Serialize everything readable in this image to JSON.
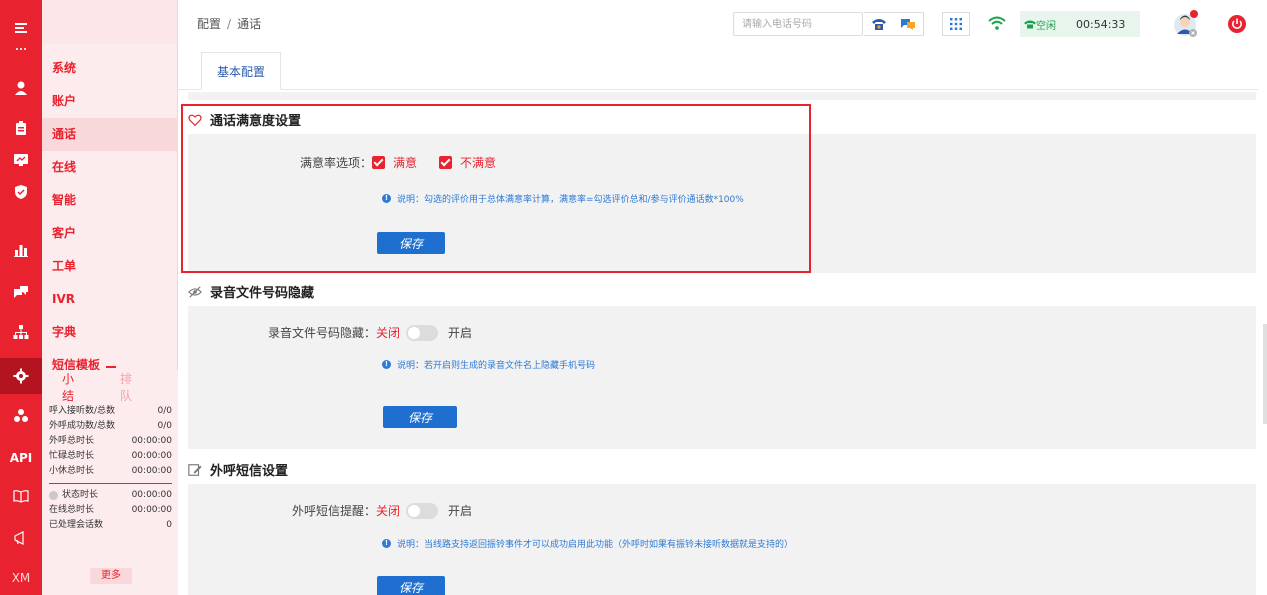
{
  "rail": {
    "icons": [
      "menu-icon",
      "user-icon",
      "clipboard-icon",
      "monitor-icon",
      "shield-icon",
      "bar-chart-icon",
      "chat-icon",
      "org-chart-icon",
      "settings-icon",
      "cluster-icon",
      "api-text",
      "book-icon",
      "megaphone-icon",
      "xm-text"
    ],
    "api_label": "API",
    "xm_label": "XM"
  },
  "submenu": {
    "items": [
      {
        "label": "系统"
      },
      {
        "label": "账户"
      },
      {
        "label": "通话"
      },
      {
        "label": "在线"
      },
      {
        "label": "智能"
      },
      {
        "label": "客户"
      },
      {
        "label": "工单"
      },
      {
        "label": "IVR"
      },
      {
        "label": "字典"
      },
      {
        "label": "短信模板"
      }
    ],
    "active_index": 2
  },
  "summary": {
    "tabs": [
      "小结",
      "排队"
    ],
    "rows_a": [
      {
        "label": "呼入接听数/总数",
        "value": "0/0"
      },
      {
        "label": "外呼成功数/总数",
        "value": "0/0"
      },
      {
        "label": "外呼总时长",
        "value": "00:00:00"
      },
      {
        "label": "忙碌总时长",
        "value": "00:00:00"
      },
      {
        "label": "小休总时长",
        "value": "00:00:00"
      }
    ],
    "rows_b": [
      {
        "label": "状态时长",
        "value": "00:00:00"
      },
      {
        "label": "在线总时长",
        "value": "00:00:00"
      },
      {
        "label": "已处理会话数",
        "value": "0"
      }
    ],
    "more": "更多"
  },
  "header": {
    "breadcrumb": [
      "配置",
      "通话"
    ],
    "breadcrumb_sep": "/",
    "phone_placeholder": "请输入电话号码",
    "status": "空闲",
    "timer": "00:54:33"
  },
  "tabs": [
    {
      "label": "基本配置"
    }
  ],
  "sections": {
    "satisfaction": {
      "title": "通话满意度设置",
      "field_label": "满意率选项：",
      "options": [
        {
          "label": "满意",
          "checked": true
        },
        {
          "label": "不满意",
          "checked": true
        }
      ],
      "note": "说明：勾选的评价用于总体满意率计算，满意率=勾选评价总和/参与评价通话数*100%",
      "save": "保存"
    },
    "recording": {
      "title": "录音文件号码隐藏",
      "field_label": "录音文件号码隐藏：",
      "off": "关闭",
      "on": "开启",
      "enabled": false,
      "note": "说明：若开启则生成的录音文件名上隐藏手机号码",
      "save": "保存"
    },
    "sms": {
      "title": "外呼短信设置",
      "field_label": "外呼短信提醒：",
      "off": "关闭",
      "on": "开启",
      "enabled": false,
      "note": "说明：当线路支持返回振铃事件才可以成功启用此功能（外呼时如果有振铃未接听数据就是支持的）",
      "save": "保存"
    }
  },
  "colors": {
    "brand_red": "#e8232f",
    "primary_blue": "#1f6fd1",
    "status_green": "#17a34a"
  }
}
